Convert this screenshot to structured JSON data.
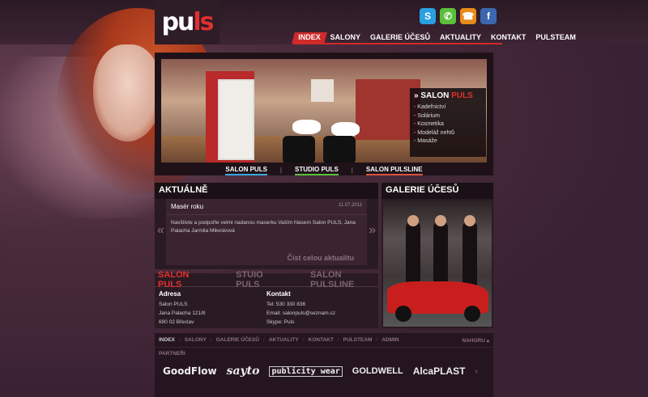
{
  "brand": {
    "logo_a": "pu",
    "logo_b": "ls"
  },
  "social": [
    {
      "icon": "skype-icon",
      "glyph": "S"
    },
    {
      "icon": "whatsapp-icon",
      "glyph": "✆"
    },
    {
      "icon": "phone-icon",
      "glyph": "☎"
    },
    {
      "icon": "facebook-icon",
      "glyph": "f"
    }
  ],
  "nav": [
    "INDEX",
    "SALONY",
    "GALERIE ÚČESŮ",
    "AKTUALITY",
    "KONTAKT",
    "PULSTEAM"
  ],
  "hero": {
    "box_title_prefix": "» SALON ",
    "box_title_brand": "PULS",
    "services": [
      "- Kadeřnictví",
      "- Solárium",
      "- Kosmetika",
      "- Modeláž nehtů",
      "- Masáže"
    ],
    "tabs": [
      "SALON PULS",
      "STUDIO PULS",
      "SALON PULSLINE"
    ]
  },
  "news": {
    "heading": "AKTUÁLNĚ",
    "title": "Masér roku",
    "date": "11.07.2011",
    "text": "Navštivte a podpořte velmi nadanou maserku Vaším hlasem Salon PULS, Jana Palacha Jarmila Mikesková",
    "more": "Číst celou aktualitu",
    "prev": "«",
    "next": "»"
  },
  "contact": {
    "tabs": [
      "SALON PULS",
      "STUIO PULS",
      "SALON PULSLINE"
    ],
    "address_title": "Adresa",
    "address": [
      "Salon PULS",
      "Jana Palacha 121/8",
      "690 02 Břeclav"
    ],
    "contact_title": "Kontakt",
    "contact": [
      "Tel: 530 330 836",
      "Email: salonpuls@seznam.cz",
      "Skype: Puls"
    ]
  },
  "gallery": {
    "heading": "GALERIE ÚČESŮ"
  },
  "footer": {
    "nav": [
      "INDEX",
      "SALONY",
      "GALERIE ÚČESŮ",
      "AKTUALITY",
      "KONTAKT",
      "PULSTEAM",
      "ADMIN"
    ],
    "top": "NAHORU",
    "partners_label": "PARTNEŘI",
    "partners": [
      "GoodFlow",
      "sayto",
      "publicity wear",
      "GOLDWELL",
      "AlcaPLAST"
    ],
    "next": "›"
  }
}
